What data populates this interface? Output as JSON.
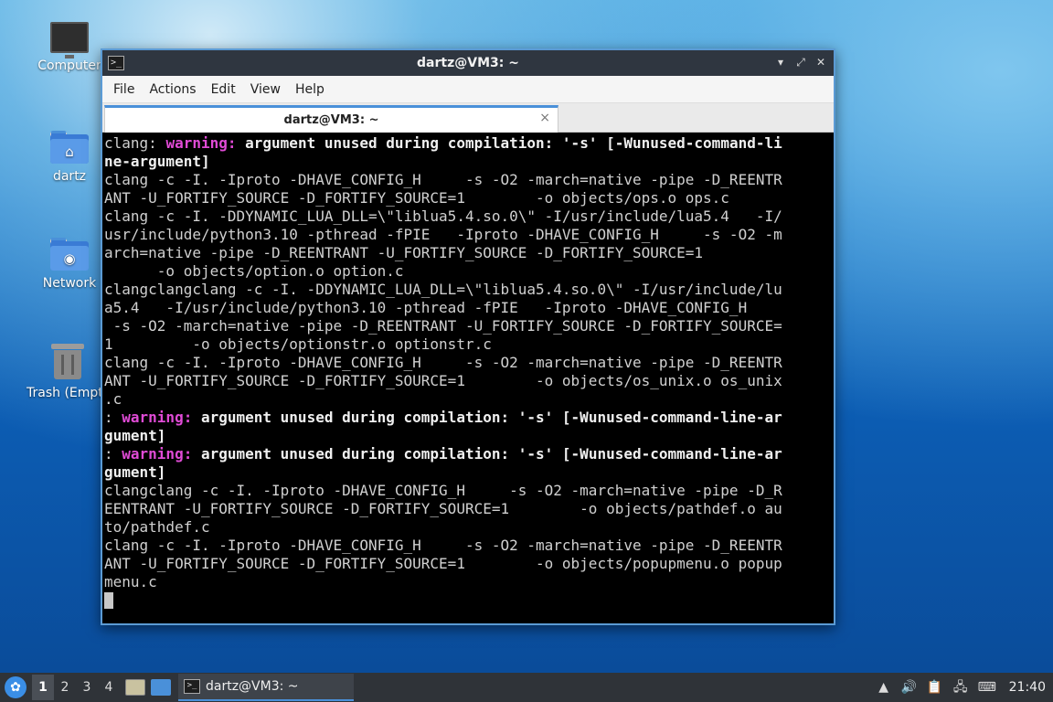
{
  "desktop": {
    "icons": [
      {
        "label": "Computer",
        "icon": "computer-icon"
      },
      {
        "label": "dartz",
        "icon": "home-folder-icon"
      },
      {
        "label": "Network",
        "icon": "network-folder-icon"
      },
      {
        "label": "Trash (Empty)",
        "icon": "trash-icon"
      }
    ]
  },
  "window": {
    "title": "dartz@VM3: ~",
    "menu": [
      "File",
      "Actions",
      "Edit",
      "View",
      "Help"
    ],
    "tab_label": "dartz@VM3: ~",
    "tab_close": "×"
  },
  "terminal": {
    "lines": [
      [
        {
          "t": "clang: ",
          "s": "n"
        },
        {
          "t": "warning: ",
          "s": "w"
        },
        {
          "t": "argument unused during compilation: '-s' [-Wunused-command-li",
          "s": "b"
        }
      ],
      [
        {
          "t": "ne-argument]",
          "s": "b"
        }
      ],
      [
        {
          "t": "clang -c -I. -Iproto -DHAVE_CONFIG_H     -s -O2 -march=native -pipe -D_REENTR",
          "s": "n"
        }
      ],
      [
        {
          "t": "ANT -U_FORTIFY_SOURCE -D_FORTIFY_SOURCE=1        -o objects/ops.o ops.c",
          "s": "n"
        }
      ],
      [
        {
          "t": "clang -c -I. -DDYNAMIC_LUA_DLL=\\\"liblua5.4.so.0\\\" -I/usr/include/lua5.4   -I/",
          "s": "n"
        }
      ],
      [
        {
          "t": "usr/include/python3.10 -pthread -fPIE   -Iproto -DHAVE_CONFIG_H     -s -O2 -m",
          "s": "n"
        }
      ],
      [
        {
          "t": "arch=native -pipe -D_REENTRANT -U_FORTIFY_SOURCE -D_FORTIFY_SOURCE=1",
          "s": "n"
        }
      ],
      [
        {
          "t": "      -o objects/option.o option.c",
          "s": "n"
        }
      ],
      [
        {
          "t": "clangclangclang -c -I. -DDYNAMIC_LUA_DLL=\\\"liblua5.4.so.0\\\" -I/usr/include/lu",
          "s": "n"
        }
      ],
      [
        {
          "t": "a5.4   -I/usr/include/python3.10 -pthread -fPIE   -Iproto -DHAVE_CONFIG_H",
          "s": "n"
        }
      ],
      [
        {
          "t": " -s -O2 -march=native -pipe -D_REENTRANT -U_FORTIFY_SOURCE -D_FORTIFY_SOURCE=",
          "s": "n"
        }
      ],
      [
        {
          "t": "1         -o objects/optionstr.o optionstr.c",
          "s": "n"
        }
      ],
      [
        {
          "t": "clang -c -I. -Iproto -DHAVE_CONFIG_H     -s -O2 -march=native -pipe -D_REENTR",
          "s": "n"
        }
      ],
      [
        {
          "t": "ANT -U_FORTIFY_SOURCE -D_FORTIFY_SOURCE=1        -o objects/os_unix.o os_unix",
          "s": "n"
        }
      ],
      [
        {
          "t": ".c",
          "s": "n"
        }
      ],
      [
        {
          "t": ": ",
          "s": "n"
        },
        {
          "t": "warning: ",
          "s": "w"
        },
        {
          "t": "argument unused during compilation: '-s' [-Wunused-command-line-ar",
          "s": "b"
        }
      ],
      [
        {
          "t": "gument]",
          "s": "b"
        }
      ],
      [
        {
          "t": ": ",
          "s": "n"
        },
        {
          "t": "warning: ",
          "s": "w"
        },
        {
          "t": "argument unused during compilation: '-s' [-Wunused-command-line-ar",
          "s": "b"
        }
      ],
      [
        {
          "t": "gument]",
          "s": "b"
        }
      ],
      [
        {
          "t": "clangclang -c -I. -Iproto -DHAVE_CONFIG_H     -s -O2 -march=native -pipe -D_R",
          "s": "n"
        }
      ],
      [
        {
          "t": "EENTRANT -U_FORTIFY_SOURCE -D_FORTIFY_SOURCE=1        -o objects/pathdef.o au",
          "s": "n"
        }
      ],
      [
        {
          "t": "to/pathdef.c",
          "s": "n"
        }
      ],
      [
        {
          "t": "clang -c -I. -Iproto -DHAVE_CONFIG_H     -s -O2 -march=native -pipe -D_REENTR",
          "s": "n"
        }
      ],
      [
        {
          "t": "ANT -U_FORTIFY_SOURCE -D_FORTIFY_SOURCE=1        -o objects/popupmenu.o popup",
          "s": "n"
        }
      ],
      [
        {
          "t": "menu.c",
          "s": "n"
        }
      ]
    ]
  },
  "taskbar": {
    "workspaces": [
      "1",
      "2",
      "3",
      "4"
    ],
    "active_workspace": "1",
    "task_label": "dartz@VM3: ~",
    "clock": "21:40"
  },
  "colors": {
    "warning": "#e04bd6",
    "accent": "#4a90d9",
    "titlebar": "#2f3640"
  }
}
